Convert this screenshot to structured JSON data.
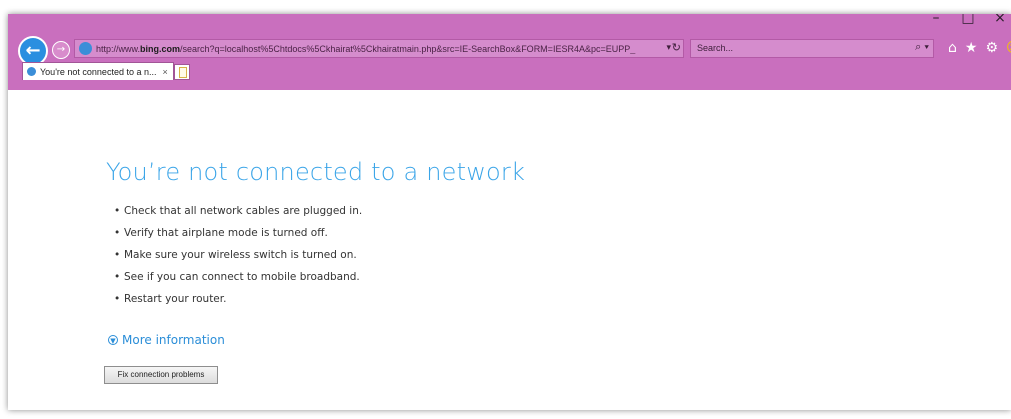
{
  "browser": {
    "window_controls": [
      "–",
      "□",
      "×"
    ],
    "url_prefix": "http://www.",
    "url_domain": "bing.com",
    "url_rest": "/search?q=localhost%5Chtdocs%5Ckhairat%5Ckhairatmain.php&src=IE-SearchBox&FORM=IESR4A&pc=EUPP_",
    "url_dropdown": "▾",
    "refresh_icon": "↻",
    "search_placeholder": "Search...",
    "search_icon": "⌕",
    "search_dropdown": "▾",
    "toolbar_icons": [
      "⌂",
      "★",
      "⚙",
      "☺"
    ],
    "tab_title": "You're not connected to a n...",
    "tab_close": "×",
    "accent_color": "#c96fbe"
  },
  "page": {
    "heading": "You’re not connected to a network",
    "tips": [
      "Check that all network cables are plugged in.",
      "Verify that airplane mode is turned off.",
      "Make sure your wireless switch is turned on.",
      "See if you can connect to mobile broadband.",
      "Restart your router."
    ],
    "more_info_label": "More information",
    "more_info_icon": "▼",
    "fix_button_label": "Fix connection problems",
    "heading_color": "#3ba5e8"
  }
}
